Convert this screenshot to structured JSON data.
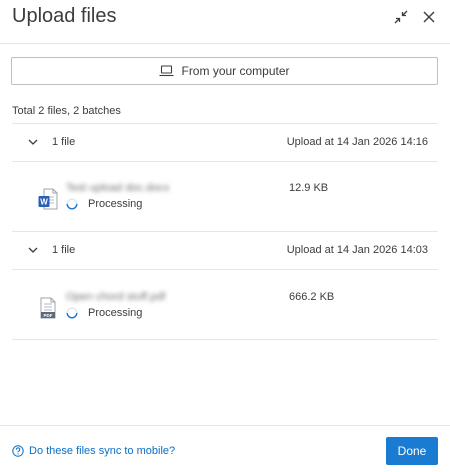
{
  "dialog": {
    "title": "Upload files",
    "upload_button_label": "From your computer",
    "total_text": "Total 2 files, 2 batches"
  },
  "batches": [
    {
      "count_label": "1 file",
      "upload_time": "Upload at 14 Jan 2026 14:16",
      "file": {
        "name": "Test upload doc.docx",
        "type_icon": "word-document-icon",
        "status": "Processing",
        "size": "12.9 KB"
      }
    },
    {
      "count_label": "1 file",
      "upload_time": "Upload at 14 Jan 2026 14:03",
      "file": {
        "name": "Open chord stuff.pdf",
        "type_icon": "pdf-document-icon",
        "status": "Processing",
        "size": "666.2 KB"
      }
    }
  ],
  "footer": {
    "help_link": "Do these files sync to mobile?",
    "done_label": "Done"
  },
  "colors": {
    "accent": "#1a7bd3",
    "link": "#0a6ec5",
    "divider": "#e6e6e6"
  }
}
